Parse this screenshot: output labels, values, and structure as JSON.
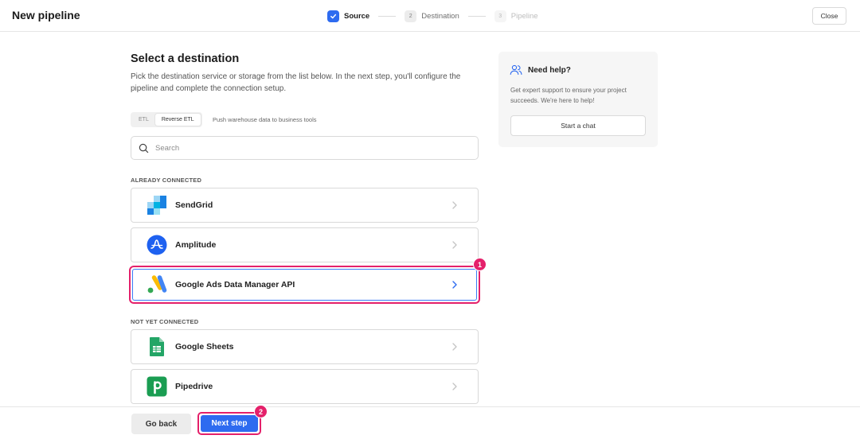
{
  "header": {
    "title": "New pipeline",
    "close_label": "Close",
    "steps": [
      {
        "number": "",
        "label": "Source",
        "state": "complete"
      },
      {
        "number": "2",
        "label": "Destination",
        "state": "current"
      },
      {
        "number": "3",
        "label": "Pipeline",
        "state": "upcoming"
      }
    ]
  },
  "main": {
    "heading": "Select a destination",
    "description": "Pick the destination service or storage from the list below. In the next step, you'll configure the pipeline and complete the connection setup.",
    "toggle": {
      "options": [
        "ETL",
        "Reverse ETL"
      ],
      "selected": "Reverse ETL",
      "description": "Push warehouse data to business tools"
    },
    "search": {
      "placeholder": "Search",
      "value": ""
    },
    "connected_label": "ALREADY CONNECTED",
    "connected": [
      {
        "name": "SendGrid",
        "icon": "sendgrid-logo"
      },
      {
        "name": "Amplitude",
        "icon": "amplitude-logo"
      },
      {
        "name": "Google Ads Data Manager API",
        "icon": "google-ads-logo"
      }
    ],
    "not_connected_label": "NOT YET CONNECTED",
    "not_connected": [
      {
        "name": "Google Sheets",
        "icon": "google-sheets-logo"
      },
      {
        "name": "Pipedrive",
        "icon": "pipedrive-logo"
      }
    ]
  },
  "help": {
    "title": "Need help?",
    "text": "Get expert support to ensure your project succeeds. We're here to help!",
    "button_label": "Start a chat"
  },
  "footer": {
    "back_label": "Go back",
    "next_label": "Next step"
  },
  "annotations": {
    "marker_1": "1",
    "marker_2": "2"
  },
  "colors": {
    "accent": "#2e6bf0",
    "annotation": "#e4206a"
  }
}
